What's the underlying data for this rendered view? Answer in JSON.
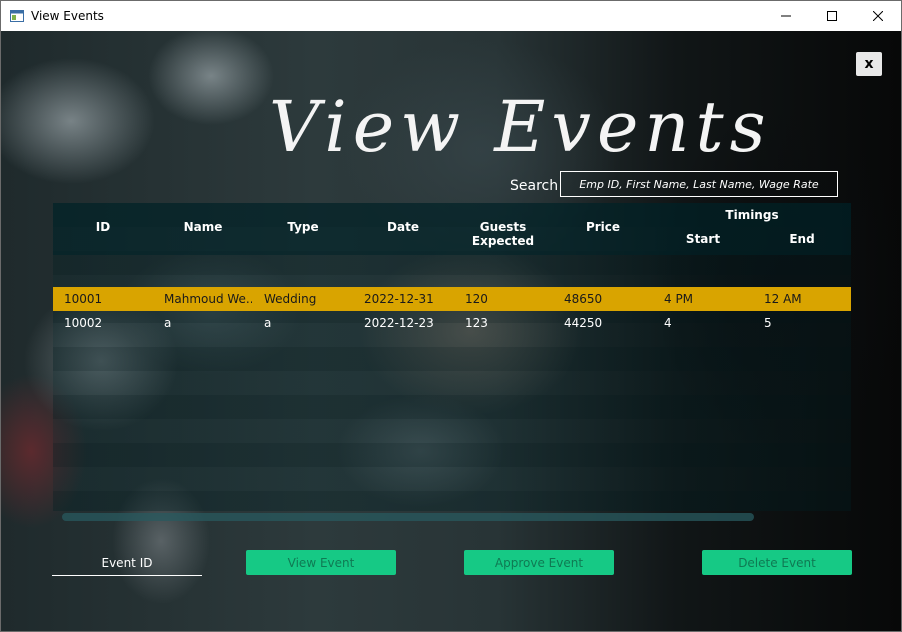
{
  "window": {
    "title": "View Events"
  },
  "heading": "View Events",
  "close_label": "x",
  "search": {
    "label": "Search",
    "placeholder": "Emp ID, First Name, Last Name, Wage Rate"
  },
  "table": {
    "columns": {
      "id": "ID",
      "name": "Name",
      "type": "Type",
      "date": "Date",
      "guests": "Guests Expected",
      "price": "Price",
      "timings": "Timings",
      "start": "Start",
      "end": "End"
    },
    "rows": [
      {
        "id": "10001",
        "name": "Mahmoud We...",
        "type": "Wedding",
        "date": "2022-12-31",
        "guests": "120",
        "price": "48650",
        "start": "4 PM",
        "end": "12 AM"
      },
      {
        "id": "10002",
        "name": "a",
        "type": "a",
        "date": "2022-12-23",
        "guests": "123",
        "price": "44250",
        "start": "4",
        "end": "5"
      }
    ]
  },
  "event_id": {
    "placeholder": "Event ID"
  },
  "buttons": {
    "view": "View Event",
    "approve": "Approve Event",
    "delete": "Delete Event"
  },
  "colors": {
    "selected_row": "#d9a400",
    "button": "#16c985",
    "button_text": "#0f7a53"
  }
}
